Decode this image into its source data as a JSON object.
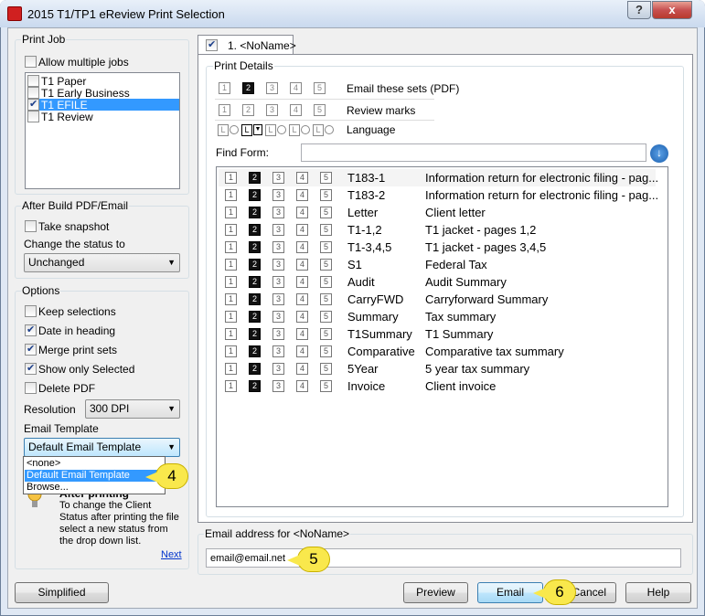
{
  "window": {
    "title": "2015 T1/TP1 eReview Print Selection",
    "help_glyph": "?",
    "close_glyph": "x"
  },
  "print_job": {
    "title": "Print Job",
    "allow_multiple": "Allow multiple jobs",
    "jobs": [
      {
        "label": "T1 Paper",
        "checked": false,
        "selected": false
      },
      {
        "label": "T1 Early Business",
        "checked": false,
        "selected": false
      },
      {
        "label": "T1 EFILE",
        "checked": true,
        "selected": true
      },
      {
        "label": "T1 Review",
        "checked": false,
        "selected": false
      }
    ]
  },
  "after_build": {
    "title": "After Build PDF/Email",
    "take_snapshot": "Take snapshot",
    "change_status_label": "Change the status to",
    "status_value": "Unchanged"
  },
  "options": {
    "title": "Options",
    "keep_selections": "Keep selections",
    "date_in_heading": "Date in heading",
    "merge_print_sets": "Merge print sets",
    "show_only_selected": "Show only Selected",
    "delete_pdf": "Delete PDF",
    "resolution_label": "Resolution",
    "resolution_value": "300 DPI",
    "email_template_label": "Email Template",
    "email_template_value": "Default Email Template",
    "dropdown_options": [
      "<none>",
      "Default Email Template",
      "Browse..."
    ]
  },
  "tip": {
    "title": "After printing",
    "text": "To change the Client Status after printing the file select a new status from the drop down list.",
    "next": "Next"
  },
  "tab": {
    "label": "1. <NoName>"
  },
  "print_details": {
    "title": "Print Details",
    "set_numbers": [
      "1",
      "2",
      "3",
      "4",
      "5"
    ],
    "email_sets_label": "Email these sets (PDF)",
    "review_marks_label": "Review marks",
    "language_label": "Language",
    "language_value": "L",
    "find_form_label": "Find Form:",
    "find_form_value": ""
  },
  "forms": [
    {
      "code": "T183-1",
      "desc": "Information return for electronic filing - pag..."
    },
    {
      "code": "T183-2",
      "desc": "Information return for electronic filing - pag..."
    },
    {
      "code": "Letter",
      "desc": "Client letter"
    },
    {
      "code": "T1-1,2",
      "desc": "T1 jacket - pages 1,2"
    },
    {
      "code": "T1-3,4,5",
      "desc": "T1 jacket - pages 3,4,5"
    },
    {
      "code": "S1",
      "desc": "Federal Tax"
    },
    {
      "code": "Audit",
      "desc": "Audit Summary"
    },
    {
      "code": "CarryFWD",
      "desc": "Carryforward Summary"
    },
    {
      "code": "Summary",
      "desc": "Tax summary"
    },
    {
      "code": "T1Summary",
      "desc": "T1 Summary"
    },
    {
      "code": "Comparative",
      "desc": "Comparative tax summary"
    },
    {
      "code": "5Year",
      "desc": "5 year tax summary"
    },
    {
      "code": "Invoice",
      "desc": "Client invoice"
    }
  ],
  "email": {
    "label": "Email address for <NoName>",
    "value": "email@email.net"
  },
  "buttons": {
    "simplified": "Simplified",
    "preview": "Preview",
    "email": "Email",
    "cancel": "Cancel",
    "help": "Help"
  },
  "callouts": {
    "four": "4",
    "five": "5",
    "six": "6"
  },
  "colors": {
    "selection": "#3399ff",
    "callout": "#f9e84c",
    "close": "#c75050"
  }
}
